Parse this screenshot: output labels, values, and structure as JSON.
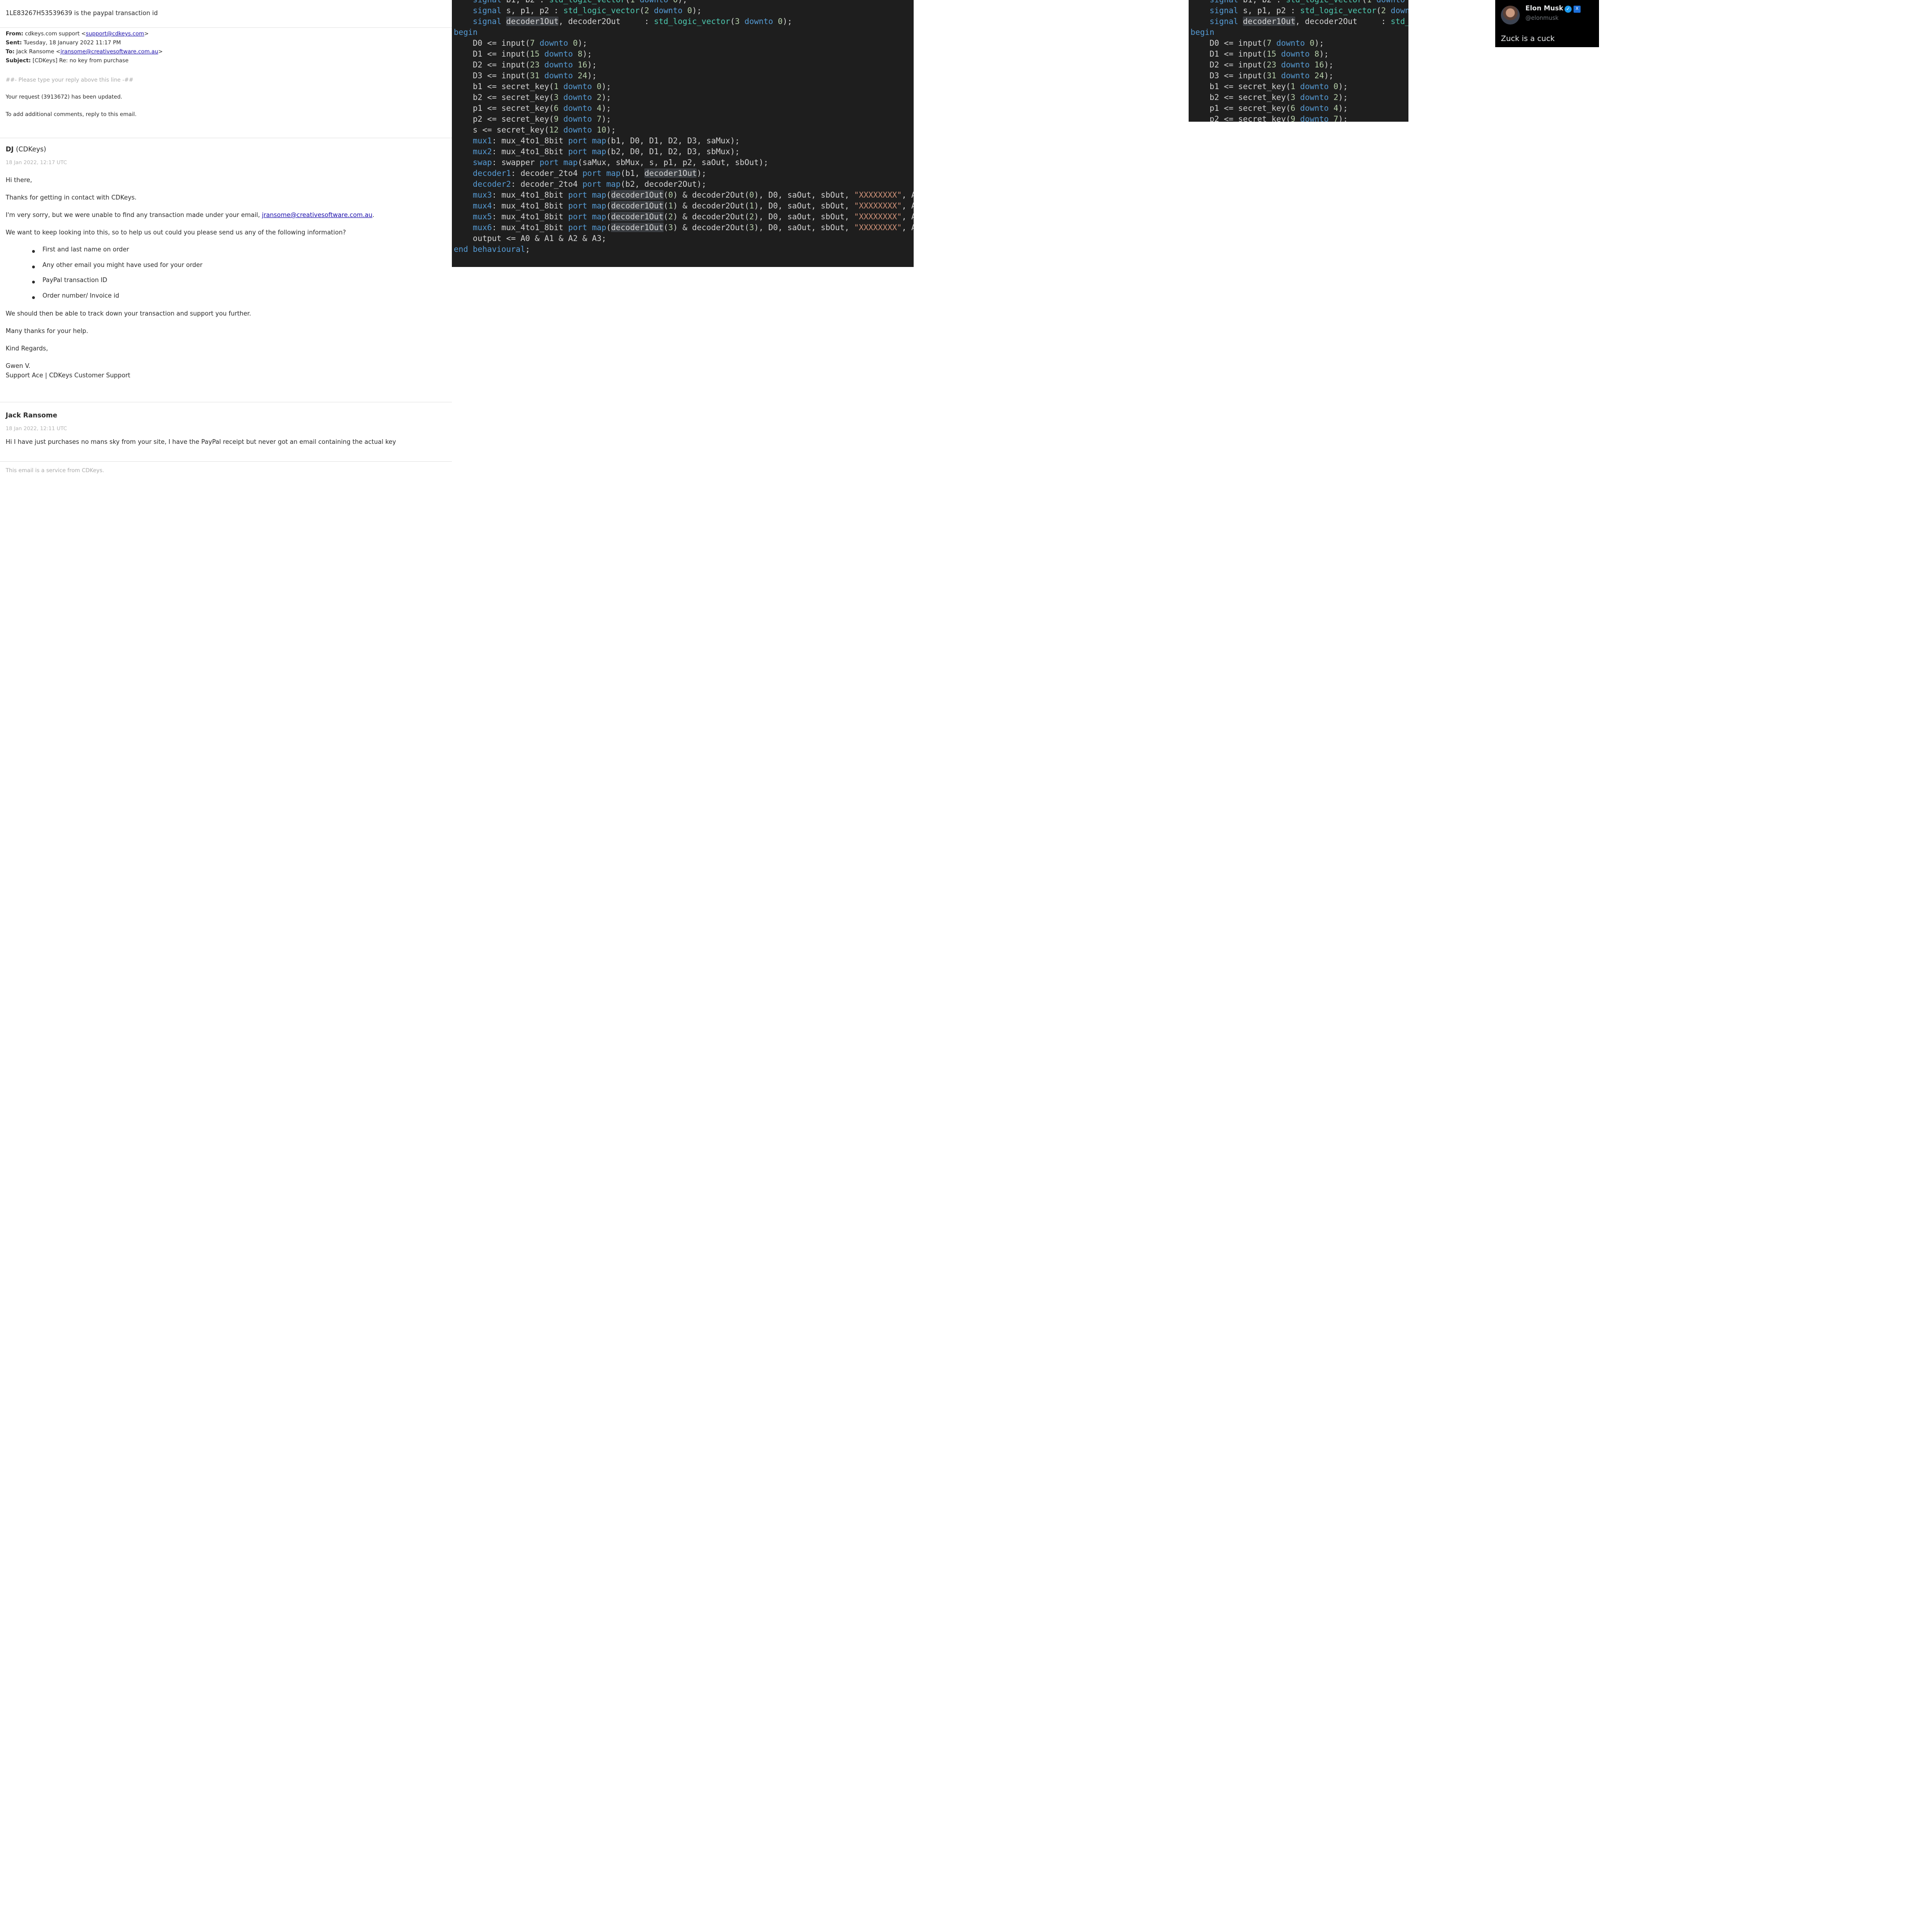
{
  "email": {
    "top_note": "1LE83267H53539639 is the paypal transaction id",
    "headers": {
      "from_label": "From:",
      "from_name": "cdkeys.com support <",
      "from_email": "support@cdkeys.com",
      "from_end": ">",
      "sent_label": "Sent:",
      "sent_value": "Tuesday, 18 January 2022 11:17 PM",
      "to_label": "To:",
      "to_name": "Jack Ransome <",
      "to_email": "jransome@creativesoftware.com.au",
      "to_end": ">",
      "subject_label": "Subject:",
      "subject_value": "[CDKeys] Re: no key from purchase"
    },
    "reply_marker": "##- Please type your reply above this line -##",
    "request_updated": "Your request (3913672) has been updated.",
    "add_comments": "To add additional comments, reply to this email.",
    "message1": {
      "author": "DJ",
      "org": "(CDKeys)",
      "date": "18 Jan 2022, 12:17 UTC",
      "greeting": "Hi there,",
      "thanks": "Thanks for getting in contact with CDKeys.",
      "sorry_prefix": "I'm very sorry, but we were unable to find any transaction made under your email, ",
      "sorry_email": "jransome@creativesoftware.com.au",
      "sorry_suffix": ".",
      "request": "We want to keep looking into this, so to help us out could you please send us any of the following information?",
      "items": [
        "First and last name on order",
        "Any other email you might have used for your order",
        "PayPal transaction ID",
        "Order number/ Invoice id"
      ],
      "track": "We should then be able to track down your transaction and support you further.",
      "many_thanks": "Many thanks for your help.",
      "regards": "Kind Regards,",
      "sig_name": "Gwen V.",
      "sig_title": "Support Ace | CDKeys Customer Support"
    },
    "message2": {
      "author": "Jack Ransome",
      "date": "18 Jan 2022, 12:11 UTC",
      "body": "Hi I have just purchases no mans sky from your site, I have the PayPal receipt but never got an email containing the actual key"
    },
    "footer": "This email is a service from CDKeys."
  },
  "code_main": [
    [
      [
        "    ",
        ""
      ],
      [
        "signal",
        "kw"
      ],
      [
        " b1, b2 : ",
        ""
      ],
      [
        "std_logic_vector",
        "ty"
      ],
      [
        "(",
        ""
      ],
      [
        "1",
        "nm"
      ],
      [
        " ",
        ""
      ],
      [
        "downto",
        "kw"
      ],
      [
        " ",
        ""
      ],
      [
        "0",
        "nm"
      ],
      [
        ");",
        ""
      ]
    ],
    [
      [
        "    ",
        ""
      ],
      [
        "signal",
        "kw"
      ],
      [
        " s, p1, p2 : ",
        ""
      ],
      [
        "std_logic_vector",
        "ty"
      ],
      [
        "(",
        ""
      ],
      [
        "2",
        "nm"
      ],
      [
        " ",
        ""
      ],
      [
        "downto",
        "kw"
      ],
      [
        " ",
        ""
      ],
      [
        "0",
        "nm"
      ],
      [
        ");",
        ""
      ]
    ],
    [
      [
        "    ",
        ""
      ],
      [
        "signal",
        "kw"
      ],
      [
        " ",
        ""
      ],
      [
        "decoder1Out",
        "hl"
      ],
      [
        ", decoder2Out     : ",
        ""
      ],
      [
        "std_logic_vector",
        "ty"
      ],
      [
        "(",
        ""
      ],
      [
        "3",
        "nm"
      ],
      [
        " ",
        ""
      ],
      [
        "downto",
        "kw"
      ],
      [
        " ",
        ""
      ],
      [
        "0",
        "nm"
      ],
      [
        ");",
        ""
      ]
    ],
    [
      [
        "begin",
        "kw"
      ]
    ],
    [
      [
        "    D0 <= input(",
        ""
      ],
      [
        "7",
        "nm"
      ],
      [
        " ",
        ""
      ],
      [
        "downto",
        "kw"
      ],
      [
        " ",
        ""
      ],
      [
        "0",
        "nm"
      ],
      [
        ");",
        ""
      ]
    ],
    [
      [
        "    D1 <= input(",
        ""
      ],
      [
        "15",
        "nm"
      ],
      [
        " ",
        ""
      ],
      [
        "downto",
        "kw"
      ],
      [
        " ",
        ""
      ],
      [
        "8",
        "nm"
      ],
      [
        ");",
        ""
      ]
    ],
    [
      [
        "    D2 <= input(",
        ""
      ],
      [
        "23",
        "nm"
      ],
      [
        " ",
        ""
      ],
      [
        "downto",
        "kw"
      ],
      [
        " ",
        ""
      ],
      [
        "16",
        "nm"
      ],
      [
        ");",
        ""
      ]
    ],
    [
      [
        "    D3 <= input(",
        ""
      ],
      [
        "31",
        "nm"
      ],
      [
        " ",
        ""
      ],
      [
        "downto",
        "kw"
      ],
      [
        " ",
        ""
      ],
      [
        "24",
        "nm"
      ],
      [
        ");",
        ""
      ]
    ],
    [
      [
        "    b1 <= secret_key(",
        ""
      ],
      [
        "1",
        "nm"
      ],
      [
        " ",
        ""
      ],
      [
        "downto",
        "kw"
      ],
      [
        " ",
        ""
      ],
      [
        "0",
        "nm"
      ],
      [
        ");",
        ""
      ]
    ],
    [
      [
        "    b2 <= secret_key(",
        ""
      ],
      [
        "3",
        "nm"
      ],
      [
        " ",
        ""
      ],
      [
        "downto",
        "kw"
      ],
      [
        " ",
        ""
      ],
      [
        "2",
        "nm"
      ],
      [
        ");",
        ""
      ]
    ],
    [
      [
        "    p1 <= secret_key(",
        ""
      ],
      [
        "6",
        "nm"
      ],
      [
        " ",
        ""
      ],
      [
        "downto",
        "kw"
      ],
      [
        " ",
        ""
      ],
      [
        "4",
        "nm"
      ],
      [
        ");",
        ""
      ]
    ],
    [
      [
        "    p2 <= secret_key(",
        ""
      ],
      [
        "9",
        "nm"
      ],
      [
        " ",
        ""
      ],
      [
        "downto",
        "kw"
      ],
      [
        " ",
        ""
      ],
      [
        "7",
        "nm"
      ],
      [
        ");",
        ""
      ]
    ],
    [
      [
        "    s <= secret_key(",
        ""
      ],
      [
        "12",
        "nm"
      ],
      [
        " ",
        ""
      ],
      [
        "downto",
        "kw"
      ],
      [
        " ",
        ""
      ],
      [
        "10",
        "nm"
      ],
      [
        ");",
        ""
      ]
    ],
    [
      [
        "    ",
        ""
      ],
      [
        "mux1",
        "kw"
      ],
      [
        ": mux_4to1_8bit ",
        ""
      ],
      [
        "port map",
        "kw"
      ],
      [
        "(b1, D0, D1, D2, D3, saMux);",
        ""
      ]
    ],
    [
      [
        "    ",
        ""
      ],
      [
        "mux2",
        "kw"
      ],
      [
        ": mux_4to1_8bit ",
        ""
      ],
      [
        "port map",
        "kw"
      ],
      [
        "(b2, D0, D1, D2, D3, sbMux);",
        ""
      ]
    ],
    [
      [
        "    ",
        ""
      ],
      [
        "swap",
        "kw"
      ],
      [
        ": swapper ",
        ""
      ],
      [
        "port map",
        "kw"
      ],
      [
        "(saMux, sbMux, s, p1, p2, saOut, sbOut);",
        ""
      ]
    ],
    [
      [
        "    ",
        ""
      ],
      [
        "decoder1",
        "kw"
      ],
      [
        ": decoder_2to4 ",
        ""
      ],
      [
        "port map",
        "kw"
      ],
      [
        "(b1, ",
        ""
      ],
      [
        "decoder1Out",
        "hl"
      ],
      [
        ");",
        ""
      ]
    ],
    [
      [
        "    ",
        ""
      ],
      [
        "decoder2",
        "kw"
      ],
      [
        ": decoder_2to4 ",
        ""
      ],
      [
        "port map",
        "kw"
      ],
      [
        "(b2, decoder2Out);",
        ""
      ]
    ],
    [
      [
        "    ",
        ""
      ],
      [
        "mux3",
        "kw"
      ],
      [
        ": mux_4to1_8bit ",
        ""
      ],
      [
        "port map",
        "kw"
      ],
      [
        "(",
        ""
      ],
      [
        "decoder1Out",
        "hl"
      ],
      [
        "(",
        ""
      ],
      [
        "0",
        "nm"
      ],
      [
        ") & decoder2Out(",
        ""
      ],
      [
        "0",
        "nm"
      ],
      [
        "), D0, saOut, sbOut, ",
        ""
      ],
      [
        "\"XXXXXXXX\"",
        "st"
      ],
      [
        ", A0);",
        ""
      ]
    ],
    [
      [
        "    ",
        ""
      ],
      [
        "mux4",
        "kw"
      ],
      [
        ": mux_4to1_8bit ",
        ""
      ],
      [
        "port map",
        "kw"
      ],
      [
        "(",
        ""
      ],
      [
        "decoder1Out",
        "hl"
      ],
      [
        "(",
        ""
      ],
      [
        "1",
        "nm"
      ],
      [
        ") & decoder2Out(",
        ""
      ],
      [
        "1",
        "nm"
      ],
      [
        "), D0, saOut, sbOut, ",
        ""
      ],
      [
        "\"XXXXXXXX\"",
        "st"
      ],
      [
        ", A1);",
        ""
      ]
    ],
    [
      [
        "    ",
        ""
      ],
      [
        "mux5",
        "kw"
      ],
      [
        ": mux_4to1_8bit ",
        ""
      ],
      [
        "port map",
        "kw"
      ],
      [
        "(",
        ""
      ],
      [
        "decoder1Out",
        "hl"
      ],
      [
        "(",
        ""
      ],
      [
        "2",
        "nm"
      ],
      [
        ") & decoder2Out(",
        ""
      ],
      [
        "2",
        "nm"
      ],
      [
        "), D0, saOut, sbOut, ",
        ""
      ],
      [
        "\"XXXXXXXX\"",
        "st"
      ],
      [
        ", A2);",
        ""
      ]
    ],
    [
      [
        "    ",
        ""
      ],
      [
        "mux6",
        "kw"
      ],
      [
        ": mux_4to1_8bit ",
        ""
      ],
      [
        "port map",
        "kw"
      ],
      [
        "(",
        ""
      ],
      [
        "decoder1Out",
        "hl"
      ],
      [
        "(",
        ""
      ],
      [
        "3",
        "nm"
      ],
      [
        ") & decoder2Out(",
        ""
      ],
      [
        "3",
        "nm"
      ],
      [
        "), D0, saOut, sbOut, ",
        ""
      ],
      [
        "\"XXXXXXXX\"",
        "st"
      ],
      [
        ", A3);",
        ""
      ]
    ],
    [
      [
        "    output <= A0 & A1 & A2 & A3;",
        ""
      ]
    ],
    [
      [
        "end",
        "kw"
      ],
      [
        " ",
        ""
      ],
      [
        "behavioural",
        "kw"
      ],
      [
        ";",
        ""
      ]
    ]
  ],
  "code_right": [
    [
      [
        "    ",
        ""
      ],
      [
        "signal",
        "kw"
      ],
      [
        " b1, b2 : ",
        ""
      ],
      [
        "std_logic_vector",
        "ty"
      ],
      [
        "(",
        ""
      ],
      [
        "1",
        "nm"
      ],
      [
        " ",
        ""
      ],
      [
        "downto",
        "kw"
      ],
      [
        " ",
        ""
      ],
      [
        "0",
        "nm"
      ],
      [
        ");",
        ""
      ]
    ],
    [
      [
        "    ",
        ""
      ],
      [
        "signal",
        "kw"
      ],
      [
        " s, p1, p2 : ",
        ""
      ],
      [
        "std_logic_vector",
        "ty"
      ],
      [
        "(",
        ""
      ],
      [
        "2",
        "nm"
      ],
      [
        " ",
        ""
      ],
      [
        "downto",
        "kw"
      ],
      [
        " ",
        ""
      ],
      [
        "0",
        "nm"
      ],
      [
        ");",
        ""
      ]
    ],
    [
      [
        "    ",
        ""
      ],
      [
        "signal",
        "kw"
      ],
      [
        " ",
        ""
      ],
      [
        "decoder1Out",
        "hl"
      ],
      [
        ", decoder2Out     : ",
        ""
      ],
      [
        "std_logic_vector",
        "ty"
      ],
      [
        "(",
        ""
      ],
      [
        "3",
        "nm"
      ],
      [
        " ",
        ""
      ],
      [
        "downto",
        "kw"
      ],
      [
        " ",
        ""
      ],
      [
        "0",
        "nm"
      ],
      [
        ");",
        ""
      ]
    ],
    [
      [
        "begin",
        "kw"
      ]
    ],
    [
      [
        "    D0 <= input(",
        ""
      ],
      [
        "7",
        "nm"
      ],
      [
        " ",
        ""
      ],
      [
        "downto",
        "kw"
      ],
      [
        " ",
        ""
      ],
      [
        "0",
        "nm"
      ],
      [
        ");",
        ""
      ]
    ],
    [
      [
        "    D1 <= input(",
        ""
      ],
      [
        "15",
        "nm"
      ],
      [
        " ",
        ""
      ],
      [
        "downto",
        "kw"
      ],
      [
        " ",
        ""
      ],
      [
        "8",
        "nm"
      ],
      [
        ");",
        ""
      ]
    ],
    [
      [
        "    D2 <= input(",
        ""
      ],
      [
        "23",
        "nm"
      ],
      [
        " ",
        ""
      ],
      [
        "downto",
        "kw"
      ],
      [
        " ",
        ""
      ],
      [
        "16",
        "nm"
      ],
      [
        ");",
        ""
      ]
    ],
    [
      [
        "    D3 <= input(",
        ""
      ],
      [
        "31",
        "nm"
      ],
      [
        " ",
        ""
      ],
      [
        "downto",
        "kw"
      ],
      [
        " ",
        ""
      ],
      [
        "24",
        "nm"
      ],
      [
        ");",
        ""
      ]
    ],
    [
      [
        "    b1 <= secret_key(",
        ""
      ],
      [
        "1",
        "nm"
      ],
      [
        " ",
        ""
      ],
      [
        "downto",
        "kw"
      ],
      [
        " ",
        ""
      ],
      [
        "0",
        "nm"
      ],
      [
        ");",
        ""
      ]
    ],
    [
      [
        "    b2 <= secret_key(",
        ""
      ],
      [
        "3",
        "nm"
      ],
      [
        " ",
        ""
      ],
      [
        "downto",
        "kw"
      ],
      [
        " ",
        ""
      ],
      [
        "2",
        "nm"
      ],
      [
        ");",
        ""
      ]
    ],
    [
      [
        "    p1 <= secret_key(",
        ""
      ],
      [
        "6",
        "nm"
      ],
      [
        " ",
        ""
      ],
      [
        "downto",
        "kw"
      ],
      [
        " ",
        ""
      ],
      [
        "4",
        "nm"
      ],
      [
        ");",
        ""
      ]
    ],
    [
      [
        "    p2 <= secret_key(",
        ""
      ],
      [
        "9",
        "nm"
      ],
      [
        " ",
        ""
      ],
      [
        "downto",
        "kw"
      ],
      [
        " ",
        ""
      ],
      [
        "7",
        "nm"
      ],
      [
        ");",
        ""
      ]
    ]
  ],
  "tweet": {
    "name": "Elon Musk",
    "verified_glyph": "✓",
    "affiliation_glyph": "X",
    "handle": "@elonmusk",
    "text": "Zuck is a cuck"
  },
  "colors": {
    "link": "#1a0dab",
    "code_bg": "#1e1e1e",
    "keyword": "#569cd6",
    "type": "#4ec9b0",
    "number": "#b5cea8",
    "string": "#ce9178",
    "tweet_bg": "#000000",
    "verified_blue": "#1d9bf0"
  }
}
